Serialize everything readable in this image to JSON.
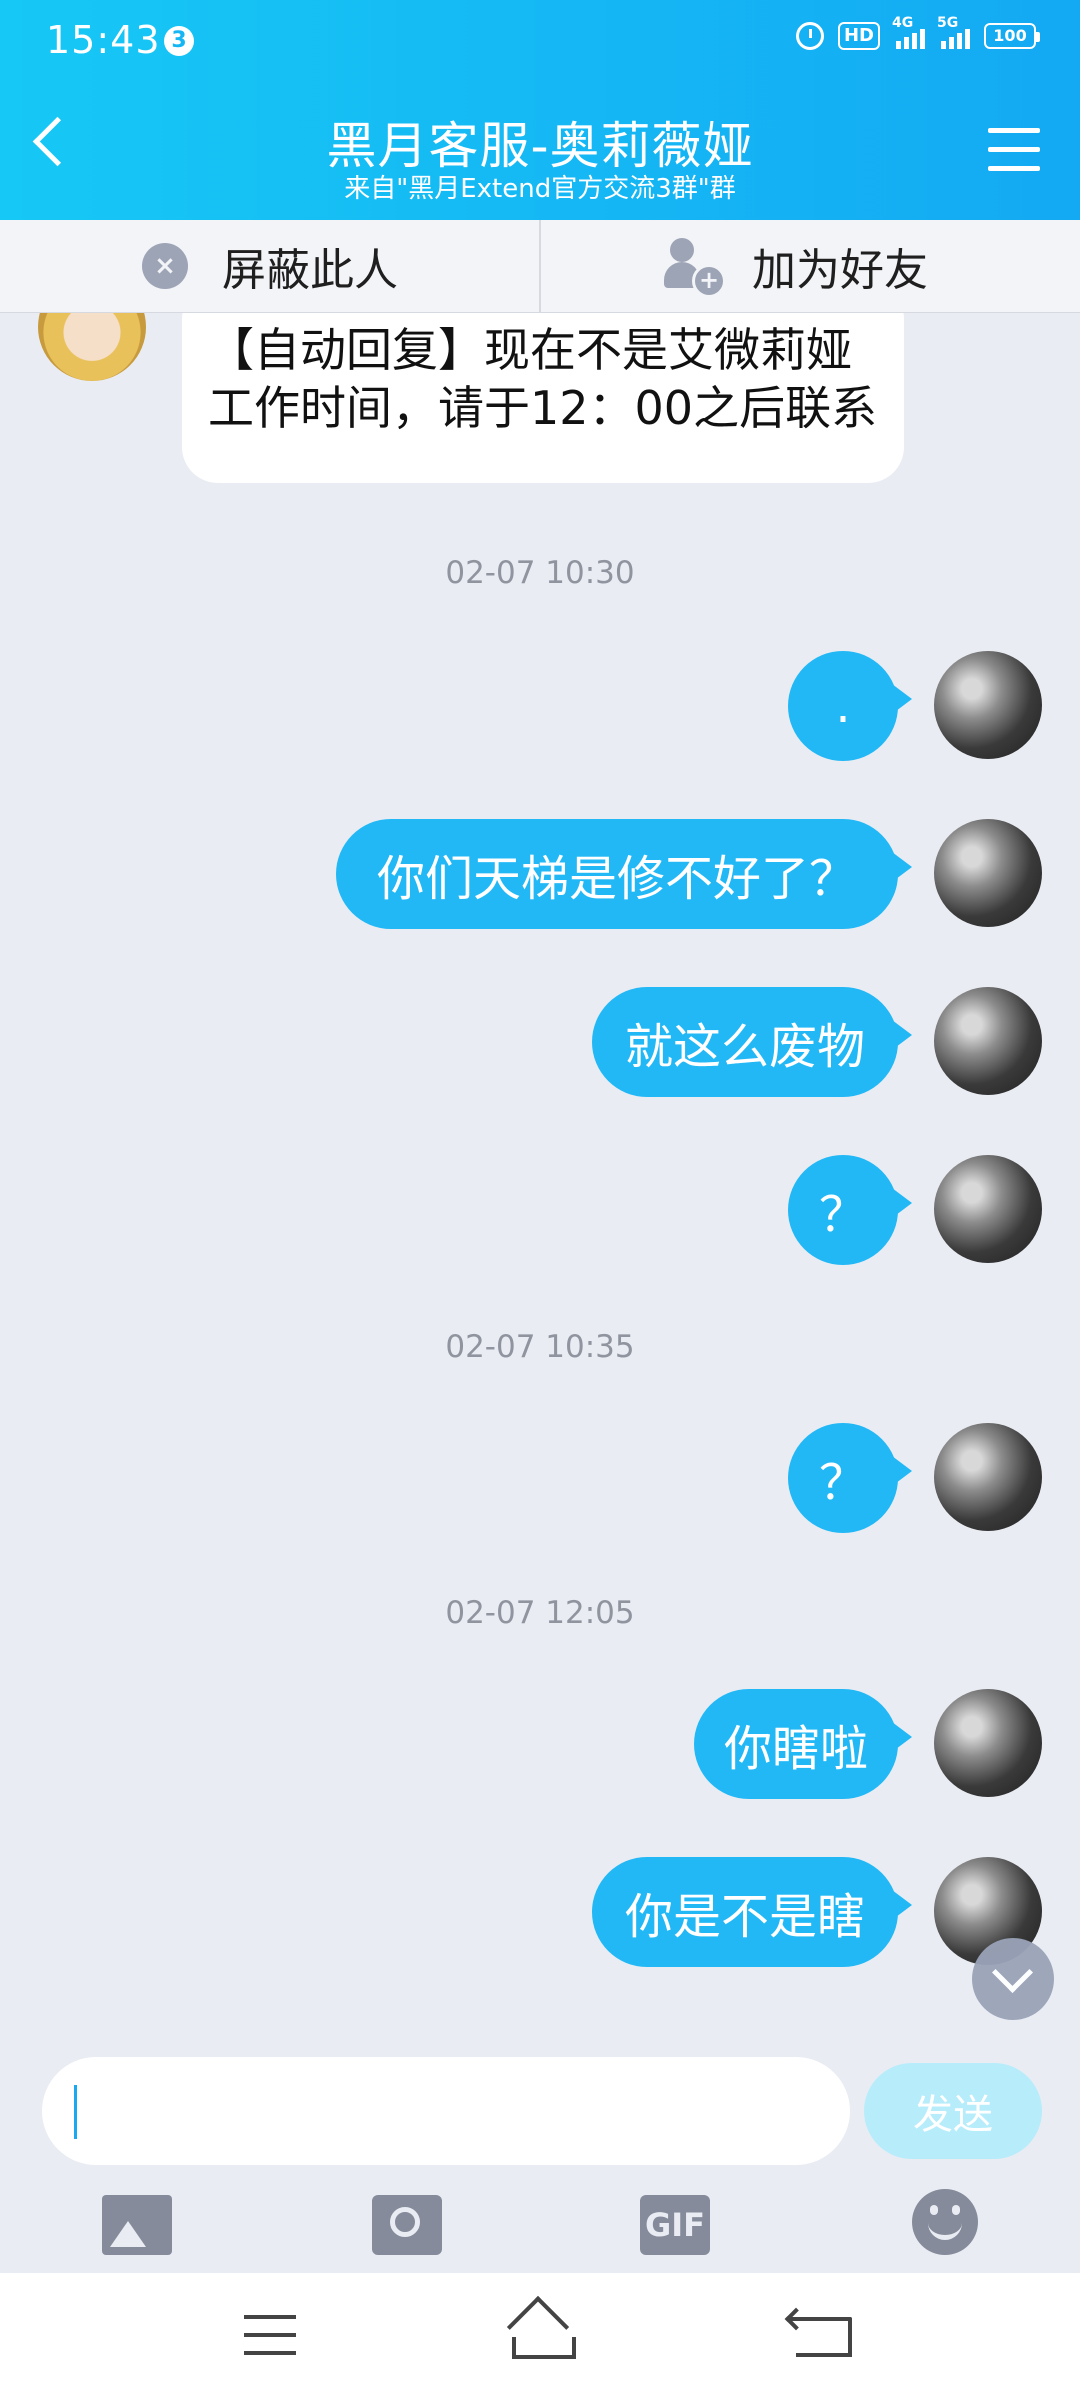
{
  "status_bar": {
    "time": "15:43",
    "notification_count": "3",
    "hd_label": "HD",
    "network1": "4G",
    "network2": "5G",
    "battery": "100"
  },
  "header": {
    "title": "黑月客服-奥莉薇娅",
    "subtitle": "来自\"黑月Extend官方交流3群\"群"
  },
  "actions": {
    "block_label": "屏蔽此人",
    "add_friend_label": "加为好友"
  },
  "messages": {
    "incoming_auto_reply": "【自动回复】现在不是艾微莉娅工作时间，请于12：00之后联系",
    "time1": "02-07 10:30",
    "m1": ".",
    "m2": "你们天梯是修不好了？",
    "m3": "就这么废物",
    "m4": "？",
    "time2": "02-07 10:35",
    "m5": "？",
    "time3": "02-07 12:05",
    "m6": "你瞎啦",
    "m7": "你是不是瞎"
  },
  "input": {
    "value": "",
    "send_label": "发送",
    "gif_label": "GIF"
  },
  "colors": {
    "header_start": "#16c8f5",
    "header_end": "#14a9f3",
    "bubble": "#22b8f6",
    "send_disabled": "#b7ecfb"
  }
}
